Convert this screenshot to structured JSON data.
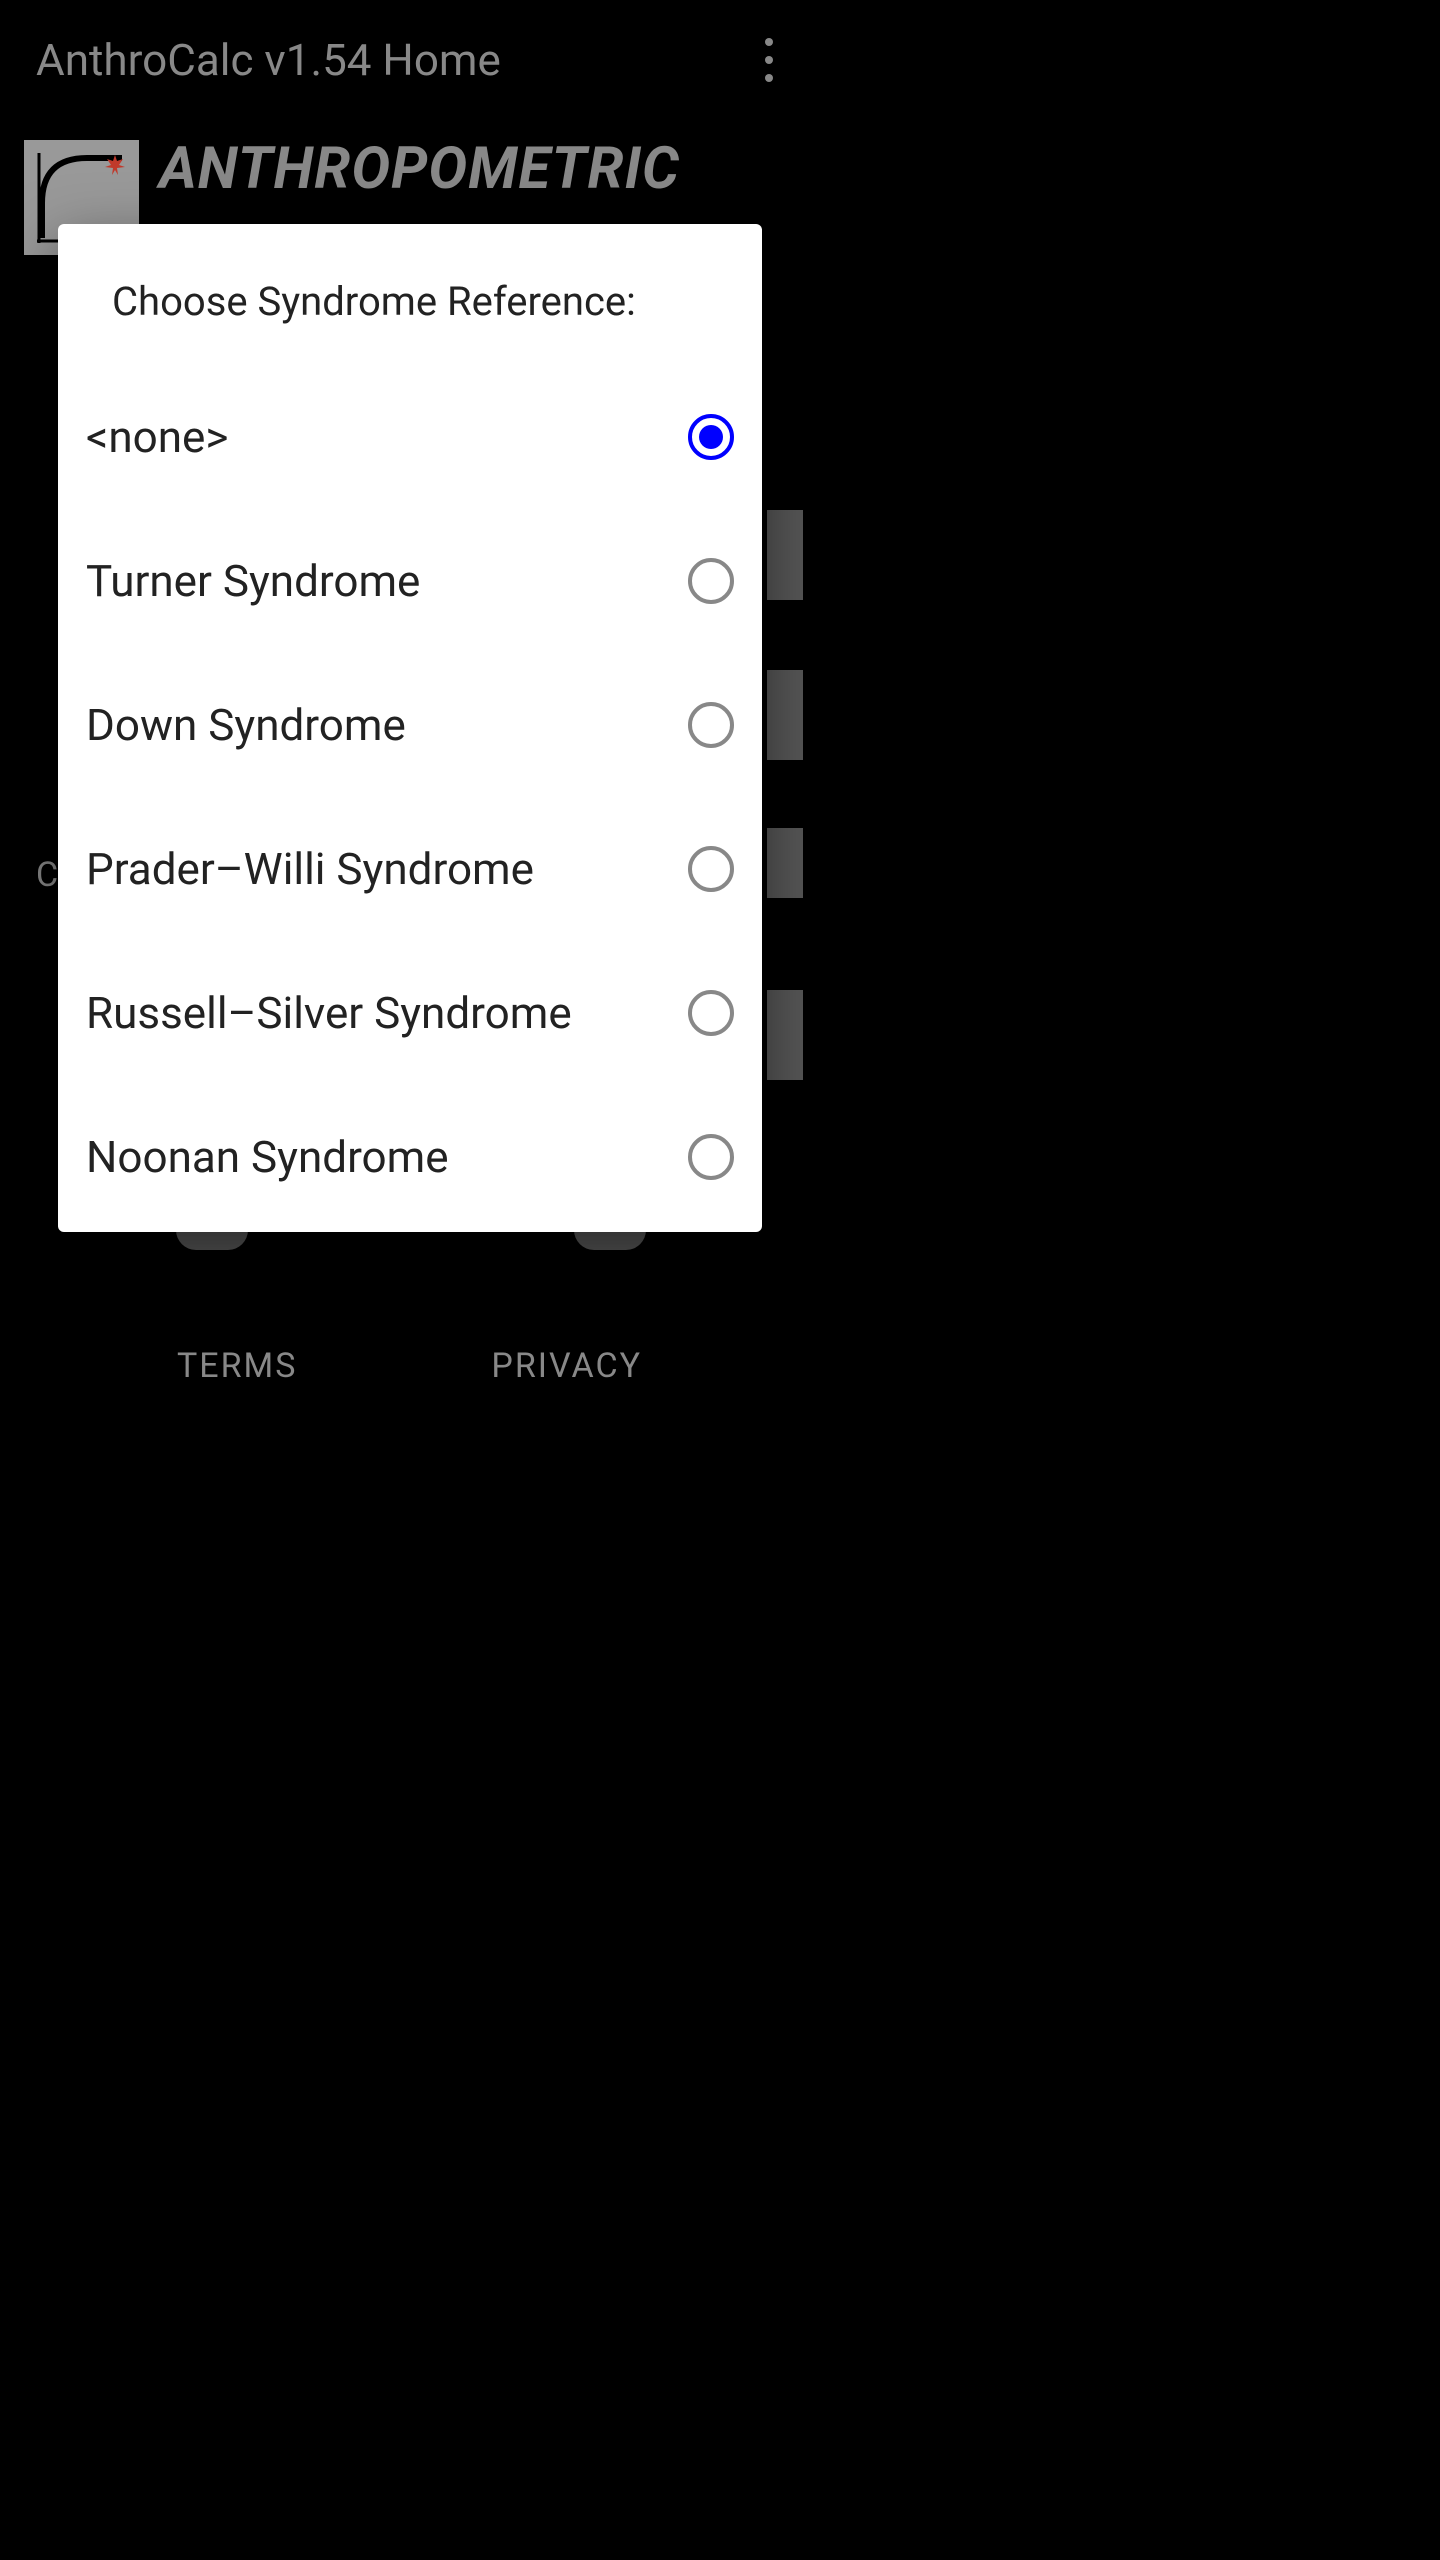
{
  "header": {
    "title": "AnthroCalc v1.54 Home"
  },
  "app": {
    "name": "ANTHROPOMETRIC"
  },
  "background": {
    "partial_label": "Ch"
  },
  "footer": {
    "terms": "TERMS",
    "privacy": "PRIVACY"
  },
  "dialog": {
    "title": "Choose Syndrome Reference:",
    "options": [
      {
        "label": "<none>",
        "selected": true
      },
      {
        "label": "Turner Syndrome",
        "selected": false
      },
      {
        "label": "Down Syndrome",
        "selected": false
      },
      {
        "label": "Prader–Willi Syndrome",
        "selected": false
      },
      {
        "label": "Russell–Silver Syndrome",
        "selected": false
      },
      {
        "label": "Noonan Syndrome",
        "selected": false
      }
    ]
  }
}
